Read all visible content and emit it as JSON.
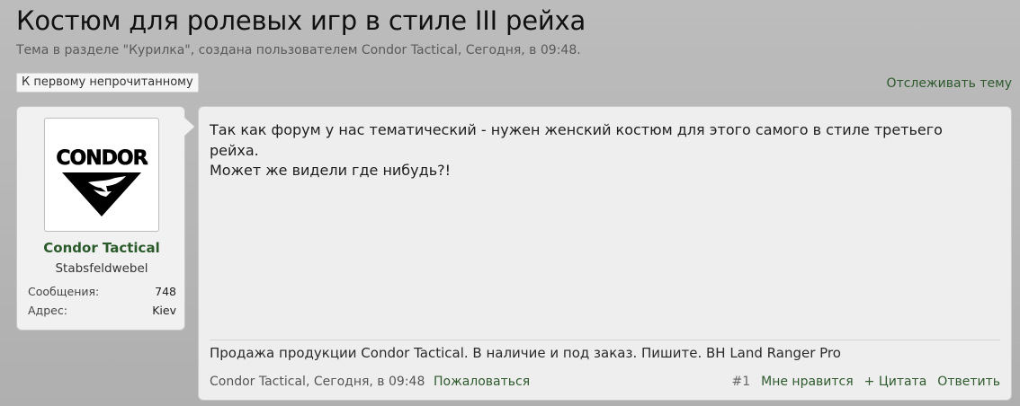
{
  "thread": {
    "title": "Костюм для ролевых игр в стиле III рейха",
    "subtitle": "Тема в разделе \"Курилка\", создана пользователем Condor Tactical, Сегодня, в 09:48."
  },
  "controls": {
    "first_unread": "К первому непрочитанному",
    "watch": "Отслеживать тему"
  },
  "user": {
    "avatar_logo_text": "CONDOR",
    "name": "Condor Tactical",
    "title": "Stabsfeldwebel",
    "stats": [
      {
        "label": "Сообщения:",
        "value": "748"
      },
      {
        "label": "Адрес:",
        "value": "Kiev"
      }
    ]
  },
  "post": {
    "lines": [
      "Так как форум у нас тематический - нужен женский костюм для этого самого в стиле третьего рейха.",
      "Может же видели где нибудь?!"
    ],
    "signature": "Продажа продукции Condor Tactical. В наличие и под заказ. Пишите. ВН Land Ranger Pro",
    "author": "Condor Tactical",
    "time": ", Сегодня, в 09:48",
    "report": "Пожаловаться",
    "number": "#1",
    "like": "Мне нравится",
    "quote": "+ Цитата",
    "reply": "Ответить"
  },
  "colors": {
    "link_green": "#2e5a2e",
    "background": "#b8b8b8",
    "panel": "#eeeeee"
  }
}
